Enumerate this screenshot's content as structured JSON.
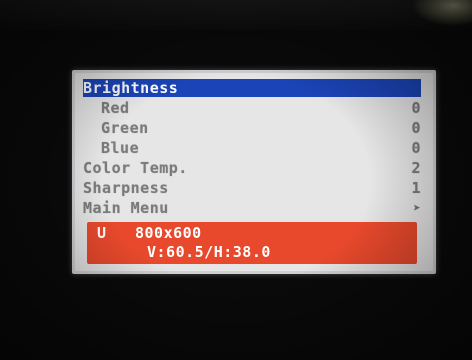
{
  "osd": {
    "menu_items": [
      {
        "label": "Brightness",
        "value": ""
      },
      {
        "label": "Red",
        "value": "0"
      },
      {
        "label": "Green",
        "value": "0"
      },
      {
        "label": "Blue",
        "value": "0"
      },
      {
        "label": "Color Temp.",
        "value": "2"
      },
      {
        "label": "Sharpness",
        "value": "1"
      },
      {
        "label": "Main Menu",
        "value": ""
      }
    ],
    "selected_index": 0,
    "status": {
      "mode": "U",
      "resolution": "800x600",
      "frequency": "V:60.5/H:38.0"
    },
    "colors": {
      "highlight": "#1b44b8",
      "status_bg": "#e8492c",
      "panel_bg": "#e6e6e6",
      "text": "#7b7b7b"
    }
  }
}
